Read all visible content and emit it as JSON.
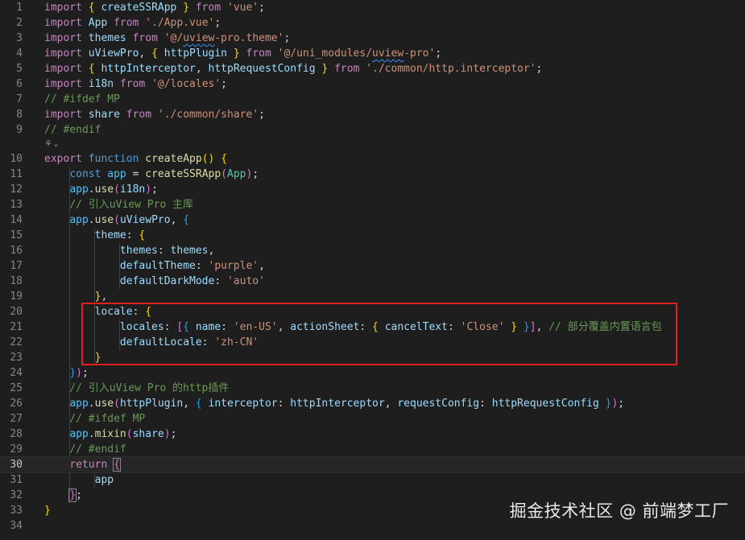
{
  "editor": {
    "language": "javascript",
    "current_line": 30,
    "fold_marker": "⚘⌄",
    "lines": [
      {
        "number": "1",
        "tokens": [
          [
            "kw",
            "import"
          ],
          [
            "p",
            " "
          ],
          [
            "b1",
            "{"
          ],
          [
            "p",
            " "
          ],
          [
            "var",
            "createSSRApp"
          ],
          [
            "p",
            " "
          ],
          [
            "b1",
            "}"
          ],
          [
            "p",
            " "
          ],
          [
            "kw",
            "from"
          ],
          [
            "p",
            " "
          ],
          [
            "str",
            "'vue'"
          ],
          [
            "p",
            ";"
          ]
        ]
      },
      {
        "number": "2",
        "tokens": [
          [
            "kw",
            "import"
          ],
          [
            "p",
            " "
          ],
          [
            "var",
            "App"
          ],
          [
            "p",
            " "
          ],
          [
            "kw",
            "from"
          ],
          [
            "p",
            " "
          ],
          [
            "str",
            "'./App.vue'"
          ],
          [
            "p",
            ";"
          ]
        ]
      },
      {
        "number": "3",
        "tokens": [
          [
            "kw",
            "import"
          ],
          [
            "p",
            " "
          ],
          [
            "var",
            "themes"
          ],
          [
            "p",
            " "
          ],
          [
            "kw",
            "from"
          ],
          [
            "p",
            " "
          ],
          [
            "str",
            "'@/"
          ],
          [
            "strsq",
            "uview"
          ],
          [
            "str",
            "-pro.theme'"
          ],
          [
            "p",
            ";"
          ]
        ]
      },
      {
        "number": "4",
        "tokens": [
          [
            "kw",
            "import"
          ],
          [
            "p",
            " "
          ],
          [
            "var",
            "uViewPro"
          ],
          [
            "p",
            ", "
          ],
          [
            "b1",
            "{"
          ],
          [
            "p",
            " "
          ],
          [
            "var",
            "httpPlugin"
          ],
          [
            "p",
            " "
          ],
          [
            "b1",
            "}"
          ],
          [
            "p",
            " "
          ],
          [
            "kw",
            "from"
          ],
          [
            "p",
            " "
          ],
          [
            "str",
            "'@/uni_modules/"
          ],
          [
            "strsq",
            "uview"
          ],
          [
            "str",
            "-pro'"
          ],
          [
            "p",
            ";"
          ]
        ]
      },
      {
        "number": "5",
        "tokens": [
          [
            "kw",
            "import"
          ],
          [
            "p",
            " "
          ],
          [
            "b1",
            "{"
          ],
          [
            "p",
            " "
          ],
          [
            "var",
            "httpInterceptor"
          ],
          [
            "p",
            ", "
          ],
          [
            "var",
            "httpRequestConfig"
          ],
          [
            "p",
            " "
          ],
          [
            "b1",
            "}"
          ],
          [
            "p",
            " "
          ],
          [
            "kw",
            "from"
          ],
          [
            "p",
            " "
          ],
          [
            "str",
            "'./common/http.interceptor'"
          ],
          [
            "p",
            ";"
          ]
        ]
      },
      {
        "number": "6",
        "tokens": [
          [
            "kw",
            "import"
          ],
          [
            "p",
            " "
          ],
          [
            "var",
            "i18n"
          ],
          [
            "p",
            " "
          ],
          [
            "kw",
            "from"
          ],
          [
            "p",
            " "
          ],
          [
            "str",
            "'@/locales'"
          ],
          [
            "p",
            ";"
          ]
        ]
      },
      {
        "number": "7",
        "tokens": [
          [
            "cmt",
            "// #ifdef MP"
          ]
        ]
      },
      {
        "number": "8",
        "tokens": [
          [
            "kw",
            "import"
          ],
          [
            "p",
            " "
          ],
          [
            "var",
            "share"
          ],
          [
            "p",
            " "
          ],
          [
            "kw",
            "from"
          ],
          [
            "p",
            " "
          ],
          [
            "str",
            "'./common/share'"
          ],
          [
            "p",
            ";"
          ]
        ]
      },
      {
        "number": "9",
        "tokens": [
          [
            "cmt",
            "// #endif"
          ]
        ]
      },
      {
        "number": "10",
        "tokens": [
          [
            "kw",
            "export"
          ],
          [
            "p",
            " "
          ],
          [
            "decl",
            "function"
          ],
          [
            "p",
            " "
          ],
          [
            "fn",
            "createApp"
          ],
          [
            "b1",
            "()"
          ],
          [
            "p",
            " "
          ],
          [
            "b1",
            "{"
          ]
        ]
      },
      {
        "number": "11",
        "tokens": [
          [
            "p",
            "    "
          ],
          [
            "decl",
            "const"
          ],
          [
            "p",
            " "
          ],
          [
            "const",
            "app"
          ],
          [
            "p",
            " = "
          ],
          [
            "fn",
            "createSSRApp"
          ],
          [
            "b2",
            "("
          ],
          [
            "cls",
            "App"
          ],
          [
            "b2",
            ")"
          ],
          [
            "p",
            ";"
          ]
        ]
      },
      {
        "number": "12",
        "tokens": [
          [
            "p",
            "    "
          ],
          [
            "const",
            "app"
          ],
          [
            "p",
            "."
          ],
          [
            "fn",
            "use"
          ],
          [
            "b2",
            "("
          ],
          [
            "var",
            "i18n"
          ],
          [
            "b2",
            ")"
          ],
          [
            "p",
            ";"
          ]
        ]
      },
      {
        "number": "13",
        "tokens": [
          [
            "p",
            "    "
          ],
          [
            "cmt",
            "// 引入uView Pro 主库"
          ]
        ]
      },
      {
        "number": "14",
        "tokens": [
          [
            "p",
            "    "
          ],
          [
            "const",
            "app"
          ],
          [
            "p",
            "."
          ],
          [
            "fn",
            "use"
          ],
          [
            "b2",
            "("
          ],
          [
            "var",
            "uViewPro"
          ],
          [
            "p",
            ", "
          ],
          [
            "b3",
            "{"
          ]
        ]
      },
      {
        "number": "15",
        "tokens": [
          [
            "p",
            "        "
          ],
          [
            "var",
            "theme"
          ],
          [
            "p",
            ": "
          ],
          [
            "b1",
            "{"
          ]
        ]
      },
      {
        "number": "16",
        "tokens": [
          [
            "p",
            "            "
          ],
          [
            "var",
            "themes"
          ],
          [
            "p",
            ": "
          ],
          [
            "var",
            "themes"
          ],
          [
            "p",
            ","
          ]
        ]
      },
      {
        "number": "17",
        "tokens": [
          [
            "p",
            "            "
          ],
          [
            "var",
            "defaultTheme"
          ],
          [
            "p",
            ": "
          ],
          [
            "str",
            "'purple'"
          ],
          [
            "p",
            ","
          ]
        ]
      },
      {
        "number": "18",
        "tokens": [
          [
            "p",
            "            "
          ],
          [
            "var",
            "defaultDarkMode"
          ],
          [
            "p",
            ": "
          ],
          [
            "str",
            "'auto'"
          ]
        ]
      },
      {
        "number": "19",
        "tokens": [
          [
            "p",
            "        "
          ],
          [
            "b1",
            "}"
          ],
          [
            "p",
            ","
          ]
        ]
      },
      {
        "number": "20",
        "tokens": [
          [
            "p",
            "        "
          ],
          [
            "var",
            "locale"
          ],
          [
            "p",
            ": "
          ],
          [
            "b1",
            "{"
          ]
        ]
      },
      {
        "number": "21",
        "tokens": [
          [
            "p",
            "            "
          ],
          [
            "var",
            "locales"
          ],
          [
            "p",
            ": "
          ],
          [
            "b2",
            "["
          ],
          [
            "b3",
            "{"
          ],
          [
            "p",
            " "
          ],
          [
            "var",
            "name"
          ],
          [
            "p",
            ": "
          ],
          [
            "str",
            "'en-US'"
          ],
          [
            "p",
            ", "
          ],
          [
            "var",
            "actionSheet"
          ],
          [
            "p",
            ": "
          ],
          [
            "b1",
            "{"
          ],
          [
            "p",
            " "
          ],
          [
            "var",
            "cancelText"
          ],
          [
            "p",
            ": "
          ],
          [
            "str",
            "'Close'"
          ],
          [
            "p",
            " "
          ],
          [
            "b1",
            "}"
          ],
          [
            "p",
            " "
          ],
          [
            "b3",
            "}"
          ],
          [
            "b2",
            "]"
          ],
          [
            "p",
            ", "
          ],
          [
            "cmt",
            "// 部分覆盖内置语言包"
          ]
        ]
      },
      {
        "number": "22",
        "tokens": [
          [
            "p",
            "            "
          ],
          [
            "var",
            "defaultLocale"
          ],
          [
            "p",
            ": "
          ],
          [
            "str",
            "'zh-CN'"
          ]
        ]
      },
      {
        "number": "23",
        "tokens": [
          [
            "p",
            "        "
          ],
          [
            "b1",
            "}"
          ]
        ]
      },
      {
        "number": "24",
        "tokens": [
          [
            "p",
            "    "
          ],
          [
            "b3",
            "}"
          ],
          [
            "b2",
            ")"
          ],
          [
            "p",
            ";"
          ]
        ]
      },
      {
        "number": "25",
        "tokens": [
          [
            "p",
            "    "
          ],
          [
            "cmt",
            "// 引入uView Pro 的http插件"
          ]
        ]
      },
      {
        "number": "26",
        "tokens": [
          [
            "p",
            "    "
          ],
          [
            "const",
            "app"
          ],
          [
            "p",
            "."
          ],
          [
            "fn",
            "use"
          ],
          [
            "b2",
            "("
          ],
          [
            "var",
            "httpPlugin"
          ],
          [
            "p",
            ", "
          ],
          [
            "b3",
            "{"
          ],
          [
            "p",
            " "
          ],
          [
            "var",
            "interceptor"
          ],
          [
            "p",
            ": "
          ],
          [
            "var",
            "httpInterceptor"
          ],
          [
            "p",
            ", "
          ],
          [
            "var",
            "requestConfig"
          ],
          [
            "p",
            ": "
          ],
          [
            "var",
            "httpRequestConfig"
          ],
          [
            "p",
            " "
          ],
          [
            "b3",
            "}"
          ],
          [
            "b2",
            ")"
          ],
          [
            "p",
            ";"
          ]
        ]
      },
      {
        "number": "27",
        "tokens": [
          [
            "p",
            "    "
          ],
          [
            "cmt",
            "// #ifdef MP"
          ]
        ]
      },
      {
        "number": "28",
        "tokens": [
          [
            "p",
            "    "
          ],
          [
            "const",
            "app"
          ],
          [
            "p",
            "."
          ],
          [
            "fn",
            "mixin"
          ],
          [
            "b2",
            "("
          ],
          [
            "var",
            "share"
          ],
          [
            "b2",
            ")"
          ],
          [
            "p",
            ";"
          ]
        ]
      },
      {
        "number": "29",
        "tokens": [
          [
            "p",
            "    "
          ],
          [
            "cmt",
            "// #endif"
          ]
        ]
      },
      {
        "number": "30",
        "tokens": [
          [
            "p",
            "    "
          ],
          [
            "kw",
            "return"
          ],
          [
            "p",
            " "
          ],
          [
            "b2c",
            "{"
          ]
        ]
      },
      {
        "number": "31",
        "tokens": [
          [
            "p",
            "        "
          ],
          [
            "var",
            "app"
          ]
        ]
      },
      {
        "number": "32",
        "tokens": [
          [
            "p",
            "    "
          ],
          [
            "b2c",
            "}"
          ],
          [
            "p",
            ";"
          ]
        ]
      },
      {
        "number": "33",
        "tokens": [
          [
            "b1",
            "}"
          ]
        ]
      },
      {
        "number": "34",
        "tokens": []
      }
    ]
  },
  "watermark": "掘金技术社区 @ 前端梦工厂"
}
